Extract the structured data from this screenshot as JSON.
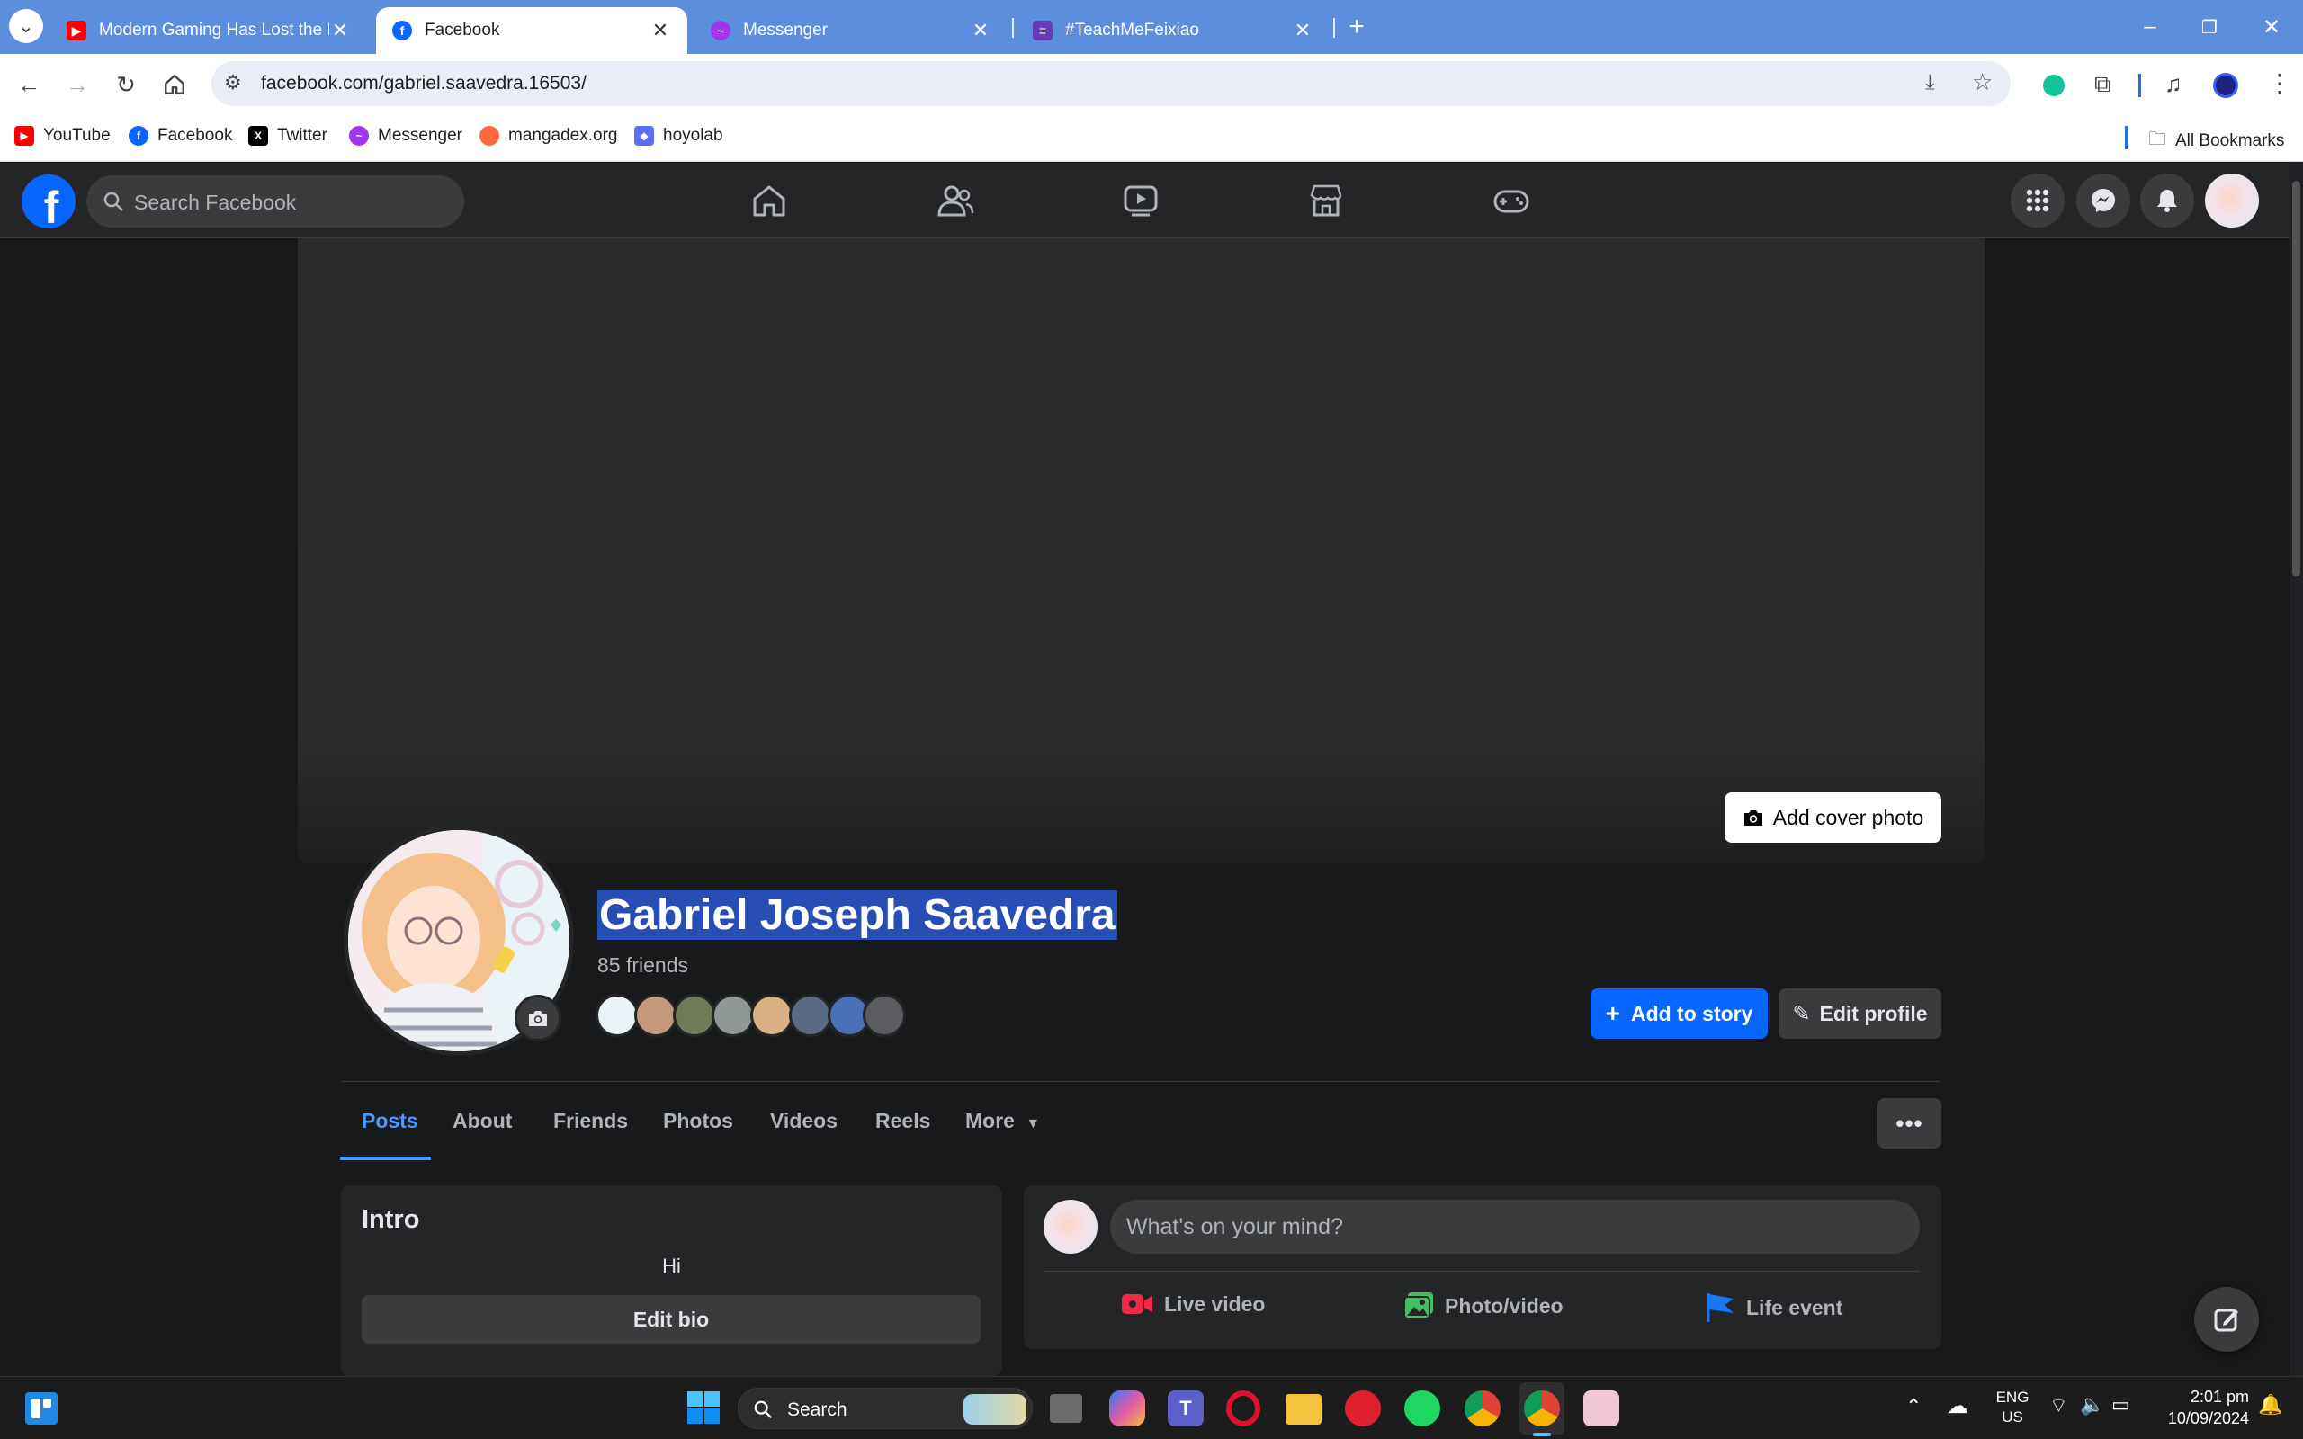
{
  "browser": {
    "tabs": [
      {
        "title": "Modern Gaming Has Lost the F",
        "favicon": "youtube-icon",
        "color": "#ff0000"
      },
      {
        "title": "Facebook",
        "favicon": "facebook-icon",
        "color": "#0866ff"
      },
      {
        "title": "Messenger",
        "favicon": "messenger-icon",
        "color": "#a335ee"
      },
      {
        "title": "#TeachMeFeixiao",
        "favicon": "doc-icon",
        "color": "#673ab7"
      }
    ],
    "url": "facebook.com/gabriel.saavedra.16503/",
    "bookmarks": [
      {
        "label": "YouTube",
        "icon": "youtube-icon",
        "color": "#ff0000"
      },
      {
        "label": "Facebook",
        "icon": "facebook-icon",
        "color": "#0866ff"
      },
      {
        "label": "Twitter",
        "icon": "x-icon",
        "color": "#000000"
      },
      {
        "label": "Messenger",
        "icon": "messenger-icon",
        "color": "#a335ee"
      },
      {
        "label": "mangadex.org",
        "icon": "mangadex-icon",
        "color": "#ff6740"
      },
      {
        "label": "hoyolab",
        "icon": "hoyolab-icon",
        "color": "#5b6ef5"
      }
    ],
    "all_bookmarks": "All Bookmarks"
  },
  "facebook": {
    "search_placeholder": "Search Facebook",
    "add_cover_photo": "Add cover photo",
    "profile_name": "Gabriel Joseph Saavedra",
    "friends_count": "85 friends",
    "add_to_story": "Add to story",
    "edit_profile": "Edit profile",
    "tabs": [
      "Posts",
      "About",
      "Friends",
      "Photos",
      "Videos",
      "Reels",
      "More"
    ],
    "intro": {
      "title": "Intro",
      "bio": "Hi",
      "edit_bio": "Edit bio"
    },
    "composer": {
      "placeholder": "What's on your mind?",
      "live_video": "Live video",
      "photo_video": "Photo/video",
      "life_event": "Life event"
    },
    "accent": "#0866ff"
  },
  "taskbar": {
    "search": "Search",
    "lang": "ENG",
    "region": "US",
    "time": "2:01 pm",
    "date": "10/09/2024"
  }
}
